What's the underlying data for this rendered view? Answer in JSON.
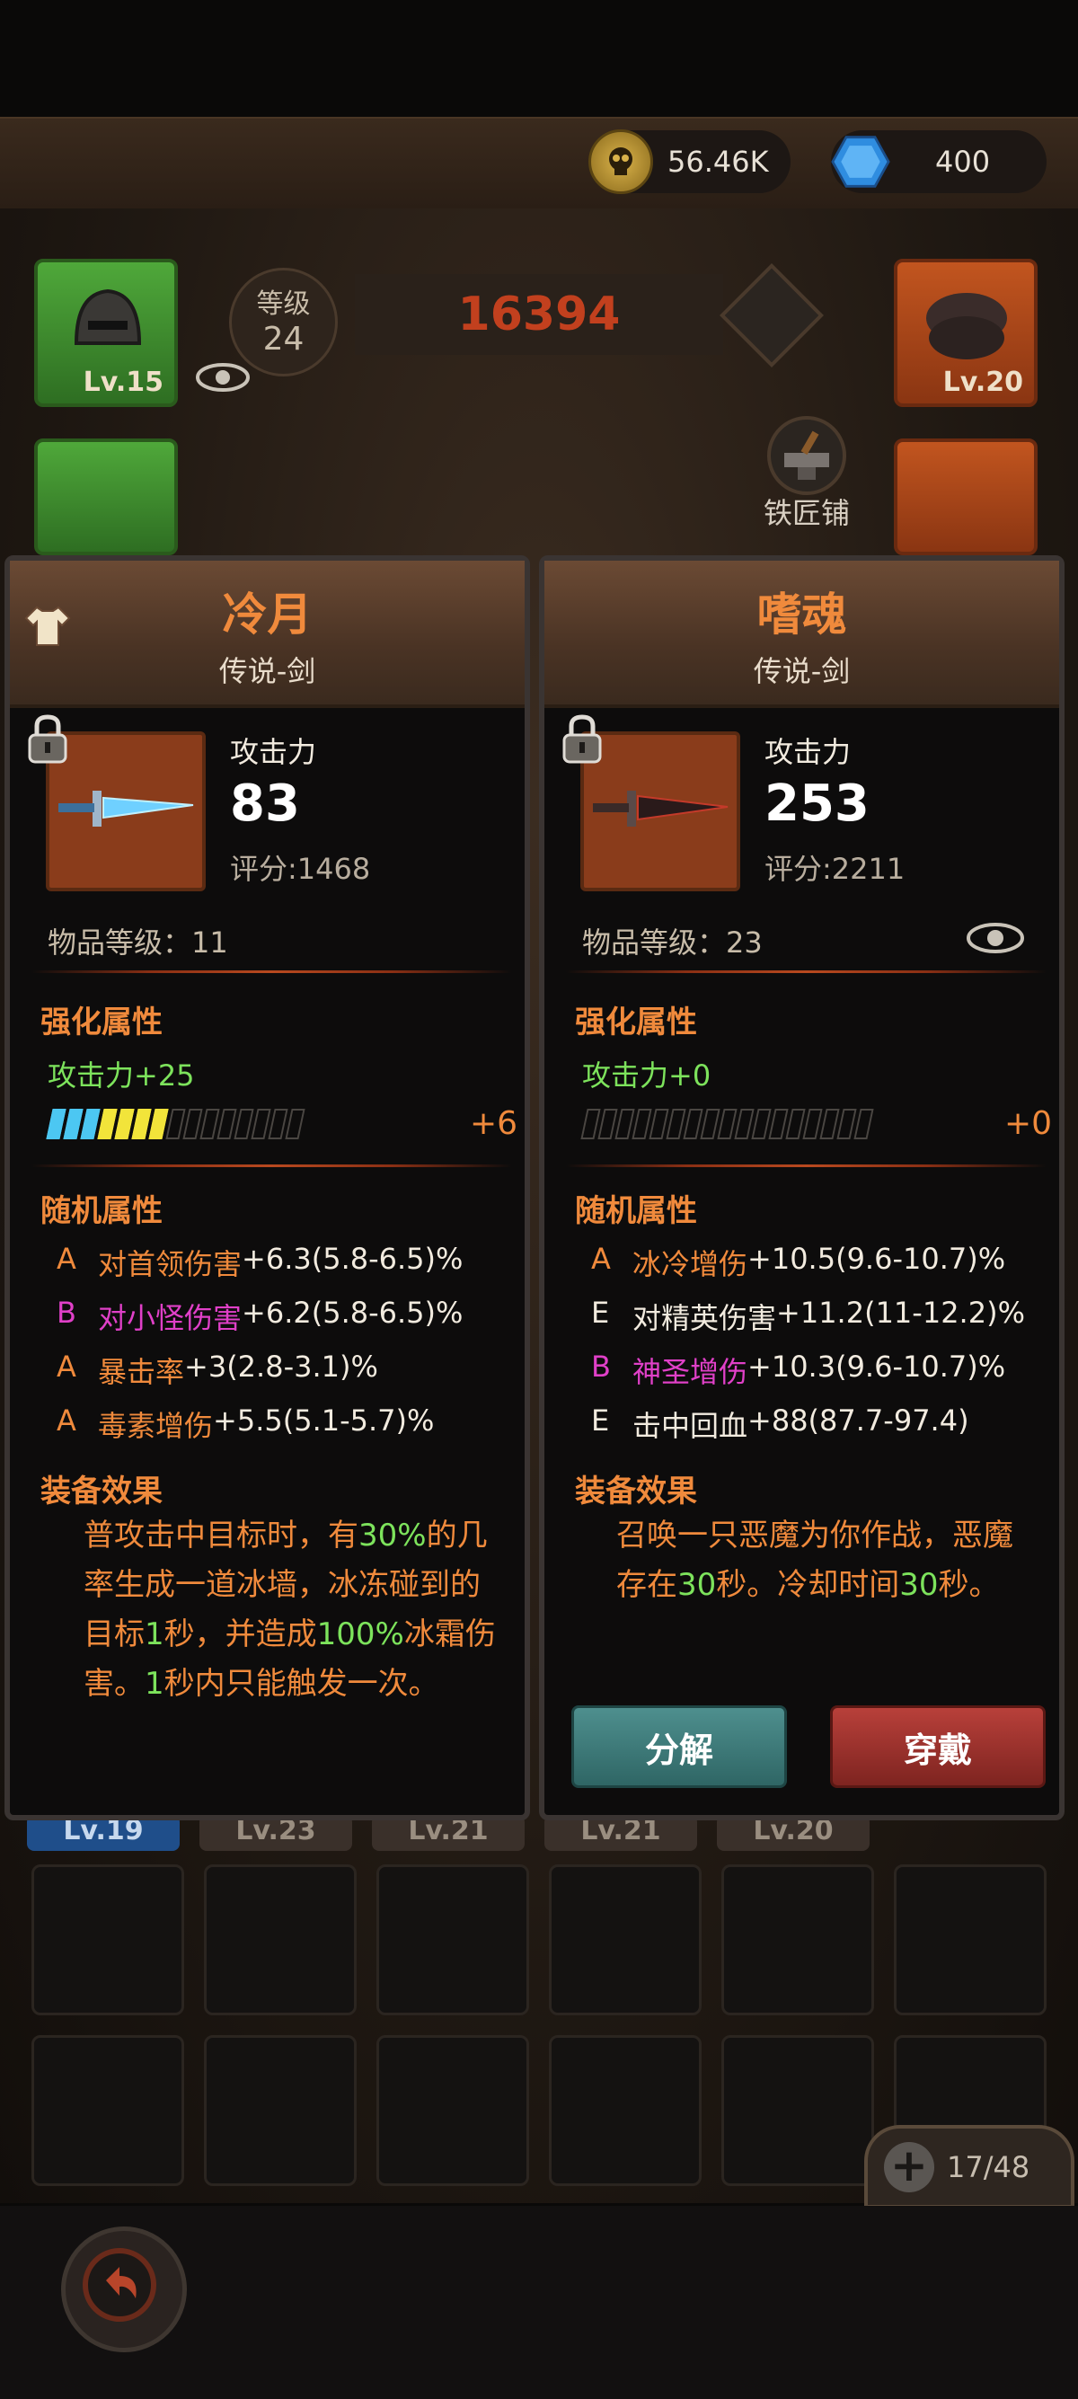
{
  "top": {
    "gold": "56.46K",
    "gems": "400",
    "gold_icon": "skull-coin-icon",
    "gem_icon": "blue-gem-icon"
  },
  "hero": {
    "level_label": "等级",
    "level": "24",
    "power": "16394",
    "blacksmith": "铁匠铺"
  },
  "equip_slots": {
    "helmet_level": "Lv.15",
    "right_top_level": "Lv.20"
  },
  "inventory": {
    "row_levels": [
      "Lv.19",
      "Lv.23",
      "Lv.21",
      "Lv.21",
      "Lv.20"
    ],
    "count": "17/48"
  },
  "left_item": {
    "name": "冷月",
    "subtitle": "传说-剑",
    "stat_label": "攻击力",
    "stat_value": "83",
    "score": "评分:1468",
    "item_level": "物品等级：11",
    "enhance_title": "强化属性",
    "enhance_stat": "攻击力+25",
    "enhance_plus": "+6",
    "enhance_filled_blue": 3,
    "enhance_filled_yellow": 4,
    "enhance_total": 15,
    "random_title": "随机属性",
    "random_attrs": [
      {
        "grade": "A",
        "name": "对首领伤害",
        "value": "+6.3(5.8-6.5)%"
      },
      {
        "grade": "B",
        "name": "对小怪伤害",
        "value": "+6.2(5.8-6.5)%"
      },
      {
        "grade": "A",
        "name": "暴击率",
        "value": "+3(2.8-3.1)%"
      },
      {
        "grade": "A",
        "name": "毒素增伤",
        "value": "+5.5(5.1-5.7)%"
      }
    ],
    "effect_title": "装备效果",
    "effect_lines": [
      [
        "普攻击中目标时，有",
        "30%",
        "的几"
      ],
      [
        "率生成一道冰墙，冰冻碰到的",
        "",
        ""
      ],
      [
        "目标",
        "1",
        "秒，并造成",
        "100%",
        "冰霜伤"
      ],
      [
        "害。",
        "1",
        "秒内只能触发一次。"
      ]
    ]
  },
  "right_item": {
    "name": "嗜魂",
    "subtitle": "传说-剑",
    "stat_label": "攻击力",
    "stat_value": "253",
    "score": "评分:2211",
    "item_level": "物品等级：23",
    "enhance_title": "强化属性",
    "enhance_stat": "攻击力+0",
    "enhance_plus": "+0",
    "enhance_total": 17,
    "random_title": "随机属性",
    "random_attrs": [
      {
        "grade": "A",
        "name": "冰冷增伤",
        "value": "+10.5(9.6-10.7)%"
      },
      {
        "grade": "E",
        "name": "对精英伤害",
        "value": "+11.2(11-12.2)%"
      },
      {
        "grade": "B",
        "name": "神圣增伤",
        "value": "+10.3(9.6-10.7)%"
      },
      {
        "grade": "E",
        "name": "击中回血",
        "value": "+88(87.7-97.4)"
      }
    ],
    "effect_title": "装备效果",
    "effect_line1_a": "召唤一只恶魔为你作战，恶魔",
    "effect_line2_a": "存在",
    "effect_line2_b": "30",
    "effect_line2_c": "秒。冷却时间",
    "effect_line2_d": "30",
    "effect_line2_e": "秒。",
    "dismantle": "分解",
    "equip": "穿戴"
  }
}
